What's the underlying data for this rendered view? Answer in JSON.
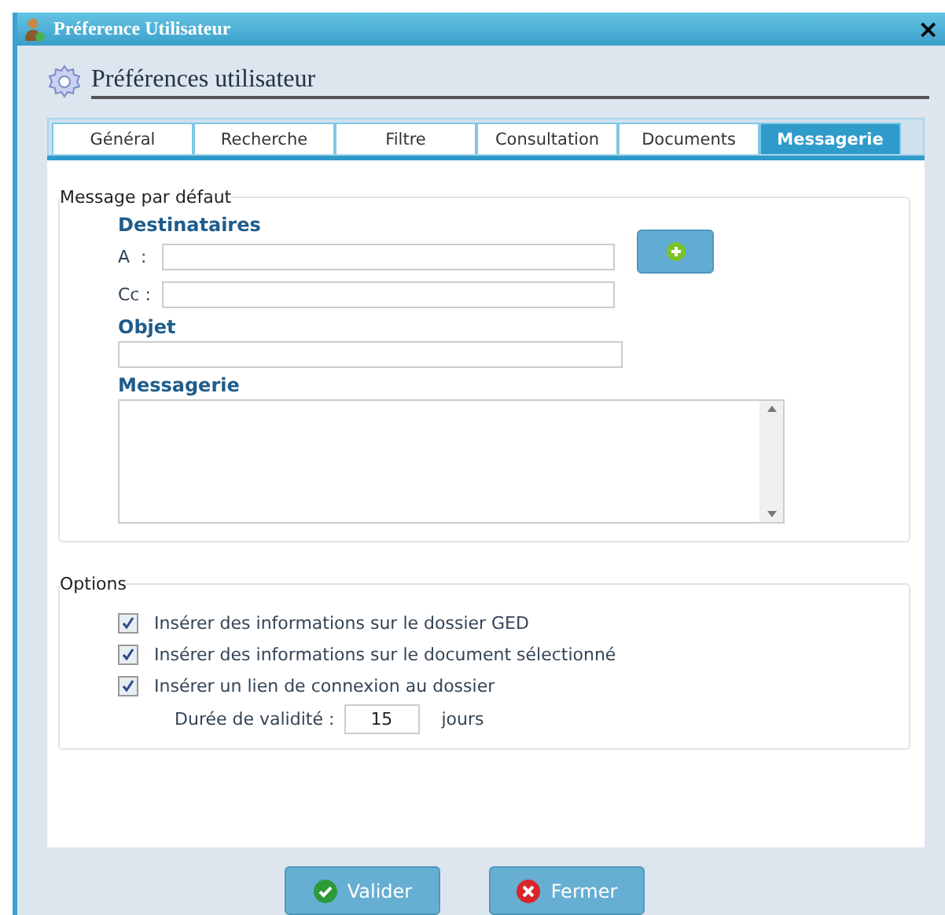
{
  "window": {
    "title": "Préference Utilisateur",
    "close": "×"
  },
  "header": {
    "title": "Préférences utilisateur"
  },
  "tabs": [
    {
      "label": "Général",
      "selected": false
    },
    {
      "label": "Recherche",
      "selected": false
    },
    {
      "label": "Filtre",
      "selected": false
    },
    {
      "label": "Consultation",
      "selected": false
    },
    {
      "label": "Documents",
      "selected": false
    },
    {
      "label": "Messagerie",
      "selected": true
    }
  ],
  "message_group": {
    "legend": "Message par défaut",
    "recipients_heading": "Destinataires",
    "to_label": "A  :",
    "cc_label": "Cc :",
    "subject_heading": "Objet",
    "body_heading": "Messagerie"
  },
  "options_group": {
    "legend": "Options",
    "options": [
      {
        "label": "Insérer des informations sur le dossier GED",
        "checked": true
      },
      {
        "label": "Insérer des informations sur le document sélectionné",
        "checked": true
      },
      {
        "label": "Insérer un lien de connexion au dossier",
        "checked": true
      }
    ],
    "validity_label": "Durée de validité :",
    "validity_value": "15",
    "validity_unit": "jours"
  },
  "buttons": [
    {
      "label": "Valider",
      "kind": "ok"
    },
    {
      "label": "Fermer",
      "kind": "close"
    }
  ]
}
